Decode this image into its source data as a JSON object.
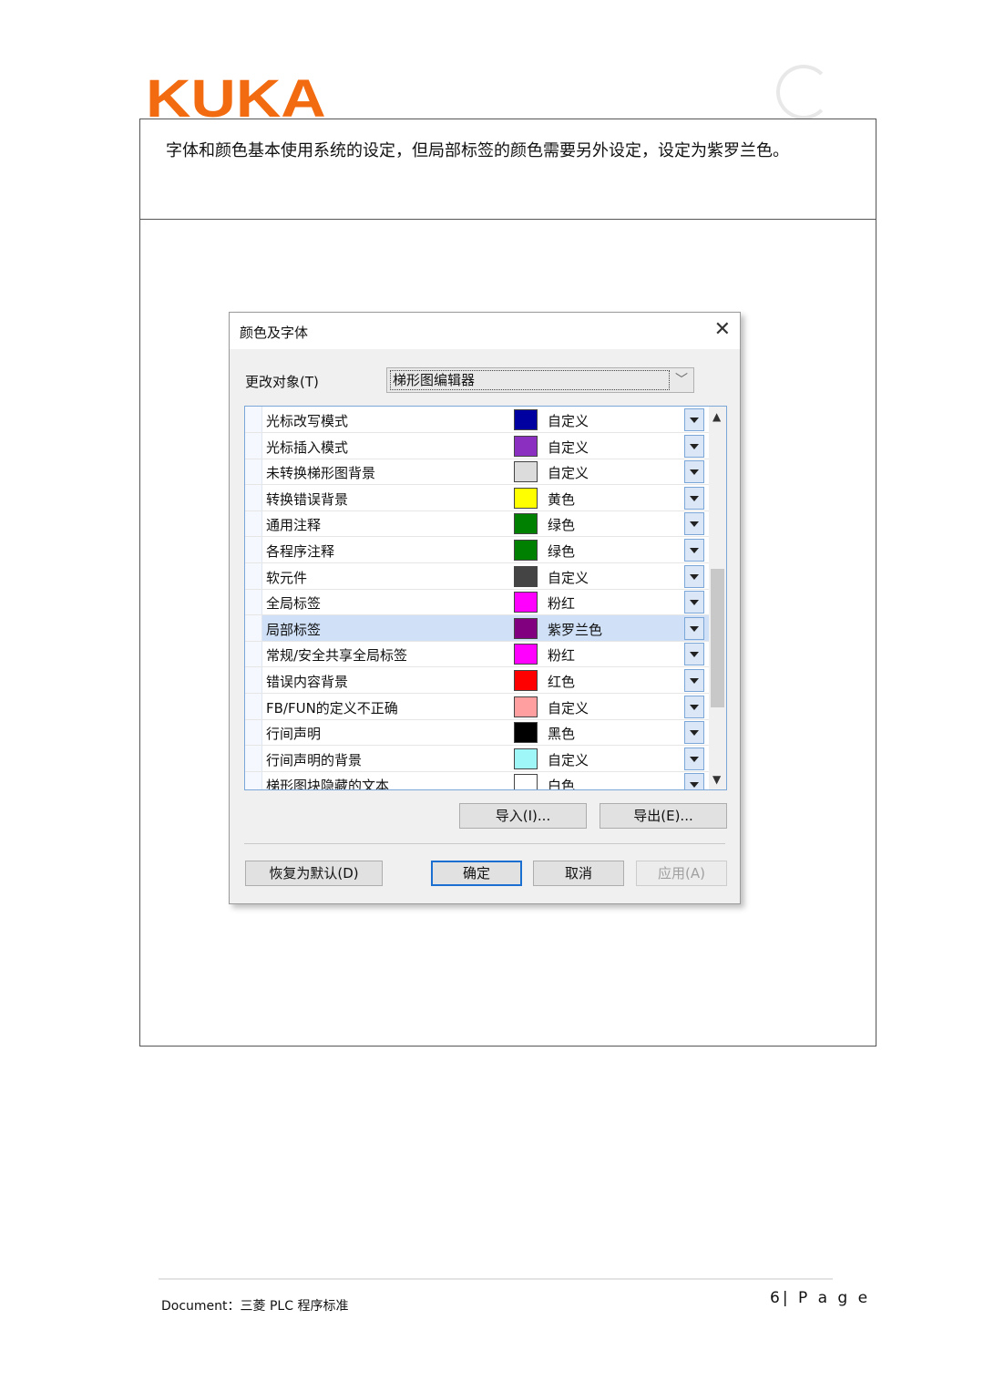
{
  "header": {
    "logo_text": "KUKA"
  },
  "caption": "字体和颜色基本使用系统的设定，但局部标签的颜色需要另外设定，设定为紫罗兰色。",
  "dialog": {
    "title": "颜色及字体",
    "close_icon": "close-icon",
    "target_label": "更改对象(T)",
    "target_value": "梯形图编辑器",
    "items": [
      {
        "name": "光标改写模式",
        "color_name": "自定义",
        "color": "#0000a0"
      },
      {
        "name": "光标插入模式",
        "color_name": "自定义",
        "color": "#8a2fc0"
      },
      {
        "name": "未转换梯形图背景",
        "color_name": "自定义",
        "color": "#dcdcdc"
      },
      {
        "name": "转换错误背景",
        "color_name": "黄色",
        "color": "#ffff00"
      },
      {
        "name": "通用注释",
        "color_name": "绿色",
        "color": "#008000"
      },
      {
        "name": "各程序注释",
        "color_name": "绿色",
        "color": "#008000"
      },
      {
        "name": "软元件",
        "color_name": "自定义",
        "color": "#444444"
      },
      {
        "name": "全局标签",
        "color_name": "粉红",
        "color": "#ff00ff"
      },
      {
        "name": "局部标签",
        "color_name": "紫罗兰色",
        "color": "#800080",
        "selected": true
      },
      {
        "name": "常规/安全共享全局标签",
        "color_name": "粉红",
        "color": "#ff00ff"
      },
      {
        "name": "错误内容背景",
        "color_name": "红色",
        "color": "#ff0000"
      },
      {
        "name": "FB/FUN的定义不正确",
        "color_name": "自定义",
        "color": "#ff9f9f"
      },
      {
        "name": "行间声明",
        "color_name": "黑色",
        "color": "#000000"
      },
      {
        "name": "行间声明的背景",
        "color_name": "自定义",
        "color": "#9ff7f7"
      },
      {
        "name": "梯形图块隐藏的文本",
        "color_name": "白色",
        "color": "#ffffff"
      }
    ],
    "import_label": "导入(I)...",
    "export_label": "导出(E)...",
    "restore_label": "恢复为默认(D)",
    "ok_label": "确定",
    "cancel_label": "取消",
    "apply_label": "应用(A)"
  },
  "footer": {
    "document": "Document：三菱 PLC 程序标准",
    "page": "6| P a g e"
  }
}
